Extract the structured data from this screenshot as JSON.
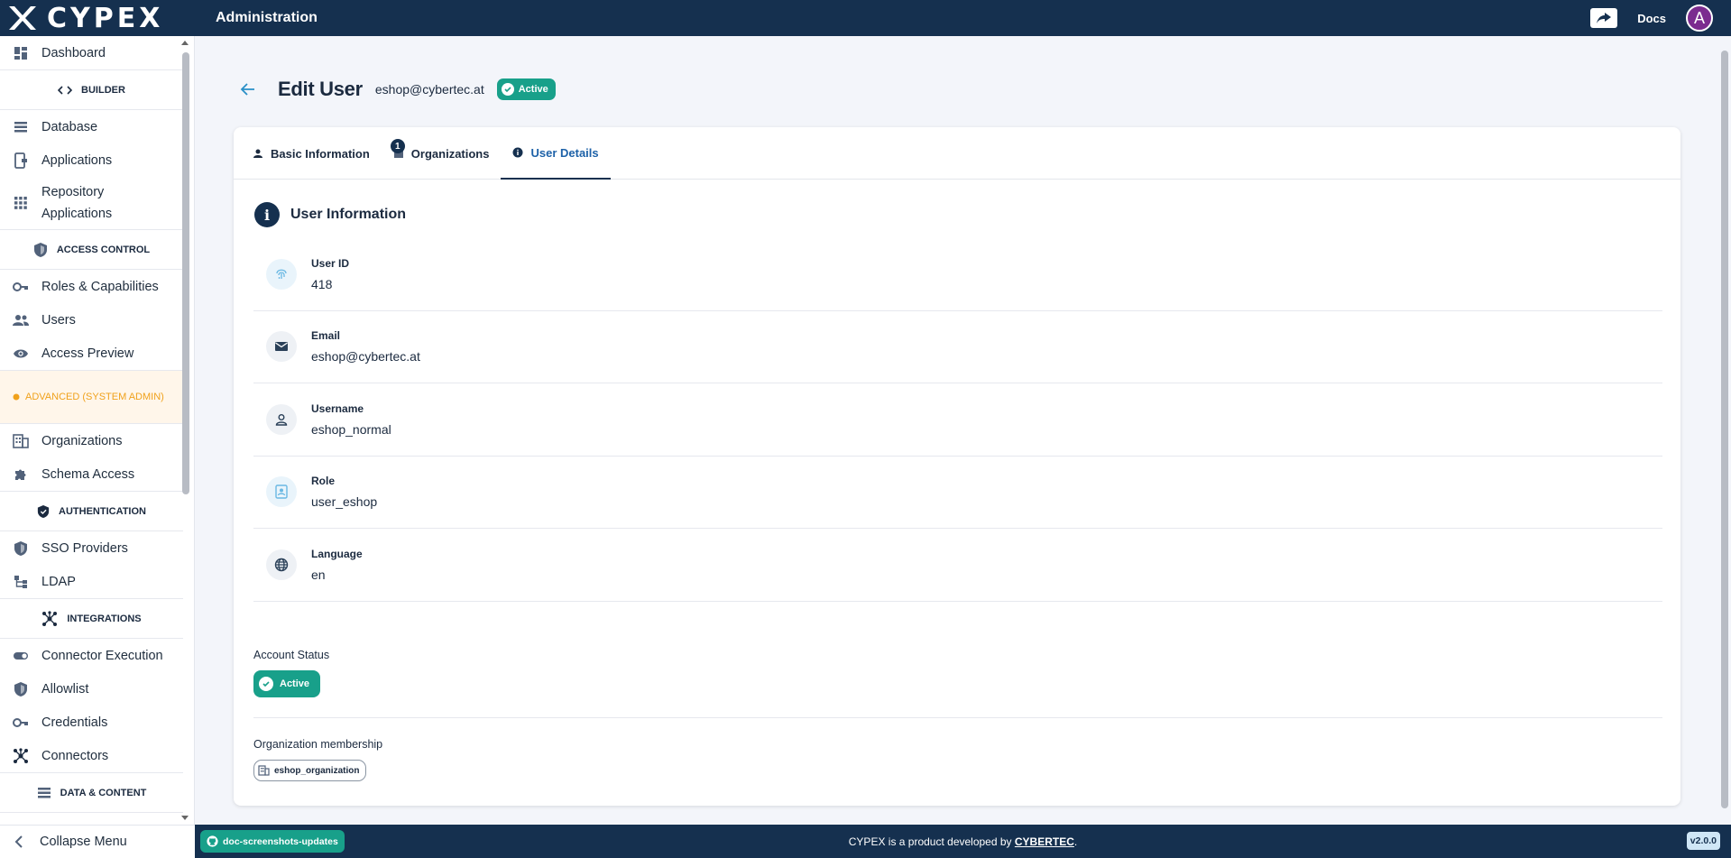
{
  "app": {
    "logo_text": "CYPEX",
    "title": "Administration"
  },
  "topbar": {
    "docs_label": "Docs",
    "avatar_letter": "A"
  },
  "sidebar": {
    "items": [
      {
        "type": "item",
        "name": "dashboard",
        "label": "Dashboard",
        "icon": "dashboard-icon"
      },
      {
        "type": "section",
        "name": "builder",
        "label": "BUILDER",
        "icon": "code-icon"
      },
      {
        "type": "item",
        "name": "database",
        "label": "Database",
        "icon": "list-icon"
      },
      {
        "type": "item",
        "name": "applications",
        "label": "Applications",
        "icon": "app-icon"
      },
      {
        "type": "item",
        "name": "repository-applications",
        "label": "Repository Applications",
        "icon": "grid-icon"
      },
      {
        "type": "section",
        "name": "access-control",
        "label": "ACCESS CONTROL",
        "icon": "shield-icon"
      },
      {
        "type": "item",
        "name": "roles-capabilities",
        "label": "Roles & Capabilities",
        "icon": "key-icon"
      },
      {
        "type": "item",
        "name": "users",
        "label": "Users",
        "icon": "people-icon"
      },
      {
        "type": "item",
        "name": "access-preview",
        "label": "Access Preview",
        "icon": "eye-icon"
      },
      {
        "type": "adv",
        "name": "advanced",
        "label": "ADVANCED (SYSTEM ADMIN)",
        "icon": "warning-dot-icon"
      },
      {
        "type": "item",
        "name": "organizations",
        "label": "Organizations",
        "icon": "building-icon"
      },
      {
        "type": "item",
        "name": "schema-access",
        "label": "Schema Access",
        "icon": "puzzle-icon"
      },
      {
        "type": "section",
        "name": "authentication",
        "label": "AUTHENTICATION",
        "icon": "shield-check-icon"
      },
      {
        "type": "item",
        "name": "sso-providers",
        "label": "SSO Providers",
        "icon": "shield-icon"
      },
      {
        "type": "item",
        "name": "ldap",
        "label": "LDAP",
        "icon": "tree-icon"
      },
      {
        "type": "section",
        "name": "integrations",
        "label": "INTEGRATIONS",
        "icon": "hub-icon"
      },
      {
        "type": "item",
        "name": "connector-execution",
        "label": "Connector Execution",
        "icon": "toggle-icon"
      },
      {
        "type": "item",
        "name": "allowlist",
        "label": "Allowlist",
        "icon": "shield-icon"
      },
      {
        "type": "item",
        "name": "credentials",
        "label": "Credentials",
        "icon": "key-icon"
      },
      {
        "type": "item",
        "name": "connectors",
        "label": "Connectors",
        "icon": "hub-icon"
      },
      {
        "type": "section",
        "name": "data-content",
        "label": "DATA & CONTENT",
        "icon": "list-icon"
      }
    ],
    "collapse_label": "Collapse Menu"
  },
  "page": {
    "title": "Edit User",
    "email": "eshop@cybertec.at",
    "status_badge": "Active"
  },
  "tabs": [
    {
      "label": "Basic Information",
      "icon": "person-icon",
      "active": false
    },
    {
      "label": "Organizations",
      "icon": "building-icon",
      "active": false,
      "count": "1"
    },
    {
      "label": "User Details",
      "icon": "info-icon",
      "active": true
    }
  ],
  "user_info": {
    "title": "User Information",
    "fields": [
      {
        "label": "User ID",
        "value": "418",
        "icon": "fingerprint-icon"
      },
      {
        "label": "Email",
        "value": "eshop@cybertec.at",
        "icon": "mail-icon"
      },
      {
        "label": "Username",
        "value": "eshop_normal",
        "icon": "person-icon"
      },
      {
        "label": "Role",
        "value": "user_eshop",
        "icon": "badge-icon"
      },
      {
        "label": "Language",
        "value": "en",
        "icon": "globe-icon"
      }
    ],
    "account_status_label": "Account Status",
    "account_status_value": "Active",
    "org_membership_label": "Organization membership",
    "org_membership": [
      "eshop_organization"
    ]
  },
  "footer": {
    "branch": "doc-screenshots-updates",
    "text_prefix": "CYPEX is a product developed by ",
    "company": "CYBERTEC",
    "text_suffix": ".",
    "version": "v2.0.0"
  },
  "colors": {
    "primary": "#15304f",
    "success": "#18a08a",
    "accent": "#2a8fc7",
    "warning": "#f0a11b"
  }
}
